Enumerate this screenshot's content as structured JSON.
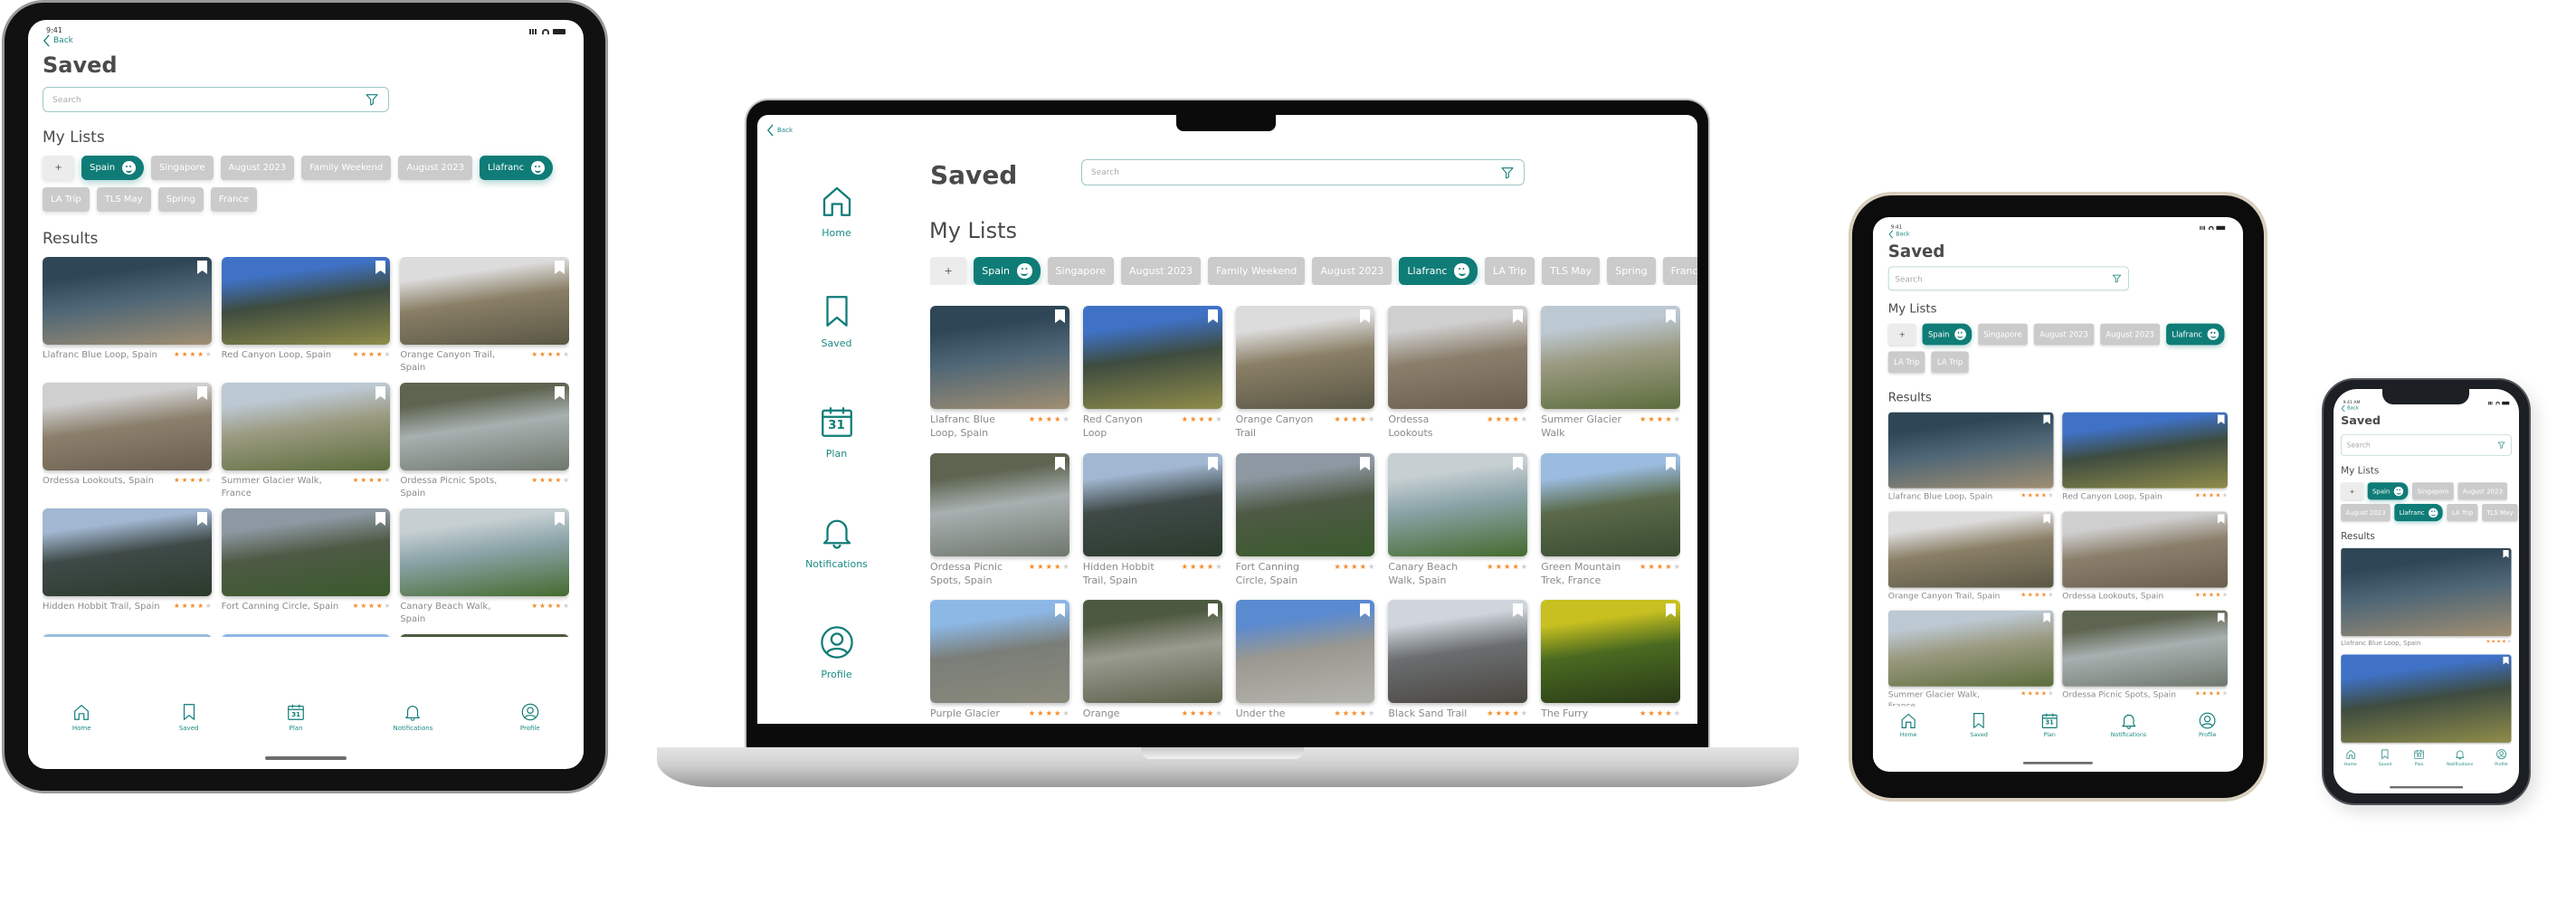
{
  "app": {
    "back": "Back",
    "title": "Saved",
    "search_placeholder": "Search",
    "my_lists": "My Lists",
    "results": "Results",
    "add_list": "+",
    "time": "9:41",
    "phone_time": "9:41 AM"
  },
  "colors": {
    "accent": "#0f7c77",
    "chip_inactive": "#cbcbcb",
    "star": "#f28c28",
    "star_empty": "#cfcfcf",
    "search_border": "#9cc9c6"
  },
  "lists": {
    "ipad": [
      [
        {
          "label": "Spain",
          "active": true
        },
        {
          "label": "Singapore"
        },
        {
          "label": "August 2023"
        },
        {
          "label": "Family Weekend"
        },
        {
          "label": "August 2023"
        },
        {
          "label": "Llafranc",
          "active": true
        }
      ],
      [
        {
          "label": "LA Trip"
        },
        {
          "label": "TLS May"
        },
        {
          "label": "Spring"
        },
        {
          "label": "France"
        }
      ]
    ],
    "laptop": [
      [
        {
          "label": "Spain",
          "active": true
        },
        {
          "label": "Singapore"
        },
        {
          "label": "August 2023"
        },
        {
          "label": "Family Weekend"
        },
        {
          "label": "August 2023"
        },
        {
          "label": "Llafranc",
          "active": true
        },
        {
          "label": "LA Trip"
        },
        {
          "label": "TLS May"
        },
        {
          "label": "Spring"
        },
        {
          "label": "France"
        }
      ]
    ],
    "mini": [
      [
        {
          "label": "Spain",
          "active": true
        },
        {
          "label": "Singapore"
        },
        {
          "label": "August 2023"
        },
        {
          "label": "August 2023"
        },
        {
          "label": "Llafranc",
          "active": true
        }
      ],
      [
        {
          "label": "LA Trip"
        },
        {
          "label": "LA Trip"
        }
      ]
    ],
    "phone": [
      [
        {
          "label": "Spain",
          "active": true
        },
        {
          "label": "Singapore"
        },
        {
          "label": "August 2023"
        }
      ],
      [
        {
          "label": "August 2023"
        },
        {
          "label": "Llafranc",
          "active": true
        },
        {
          "label": "LA Trip"
        },
        {
          "label": "TLS May"
        }
      ]
    ]
  },
  "nav": [
    {
      "label": "Home",
      "icon": "home-icon"
    },
    {
      "label": "Saved",
      "icon": "bookmark-icon"
    },
    {
      "label": "Plan",
      "icon": "calendar-icon",
      "day": "31"
    },
    {
      "label": "Notifications",
      "icon": "bell-icon"
    },
    {
      "label": "Profile",
      "icon": "profile-icon"
    }
  ],
  "results": [
    {
      "name": "Llafranc Blue Loop, Spain",
      "desktop_name": "Llafranc Blue Loop, Spain",
      "rating": 4,
      "palette": [
        "#2f4656",
        "#4e6676",
        "#a08e72"
      ]
    },
    {
      "name": "Red Canyon Loop, Spain",
      "desktop_name": "Red Canyon Loop",
      "rating": 4,
      "palette": [
        "#3f72c6",
        "#3e4c40",
        "#8f8c4a"
      ]
    },
    {
      "name": "Orange Canyon Trail, Spain",
      "desktop_name": "Orange Canyon Trail",
      "rating": 4,
      "palette": [
        "#dcdcdc",
        "#8a7f66",
        "#5a5746"
      ]
    },
    {
      "name": "Ordessa Lookouts, Spain",
      "desktop_name": "Ordessa Lookouts",
      "rating": 4,
      "palette": [
        "#cfcfcf",
        "#8b7f6c",
        "#6a5f50"
      ]
    },
    {
      "name": "Summer Glacier Walk, France",
      "desktop_name": "Summer Glacier Walk",
      "rating": 4,
      "palette": [
        "#bcc8d2",
        "#9a9a80",
        "#5b6d3c"
      ]
    },
    {
      "name": "Ordessa Picnic Spots, Spain",
      "desktop_name": "Ordessa Picnic Spots, Spain",
      "rating": 4,
      "palette": [
        "#5d6450",
        "#a8b0b0",
        "#6e776c"
      ]
    },
    {
      "name": "Hidden Hobbit Trail, Spain",
      "desktop_name": "Hidden Hobbit Trail, Spain",
      "rating": 4,
      "palette": [
        "#a2b8d2",
        "#3f4a48",
        "#2c3a2c"
      ]
    },
    {
      "name": "Fort Canning Circle, Spain",
      "desktop_name": "Fort Canning Circle, Spain",
      "rating": 4,
      "palette": [
        "#8e98a2",
        "#4e5a45",
        "#3a5a2c"
      ]
    },
    {
      "name": "Canary Beach Walk, Spain",
      "desktop_name": "Canary Beach Walk, Spain",
      "rating": 4,
      "palette": [
        "#c6cfd2",
        "#8aa3a8",
        "#456b2e"
      ]
    },
    {
      "name": "Green Mountain Trek, France",
      "desktop_name": "Green Mountain Trek, France",
      "rating": 4,
      "palette": [
        "#9bbce0",
        "#5a6a4a",
        "#3a4a30"
      ]
    },
    {
      "name": "Purple Glacier",
      "desktop_name": "Purple Glacier",
      "rating": 4,
      "palette": [
        "#8db8e6",
        "#7a7e78",
        "#8a8a7c"
      ]
    },
    {
      "name": "Orange",
      "desktop_name": "Orange",
      "rating": 4,
      "palette": [
        "#4e5a40",
        "#9a9a90",
        "#5a6048"
      ]
    },
    {
      "name": "Under the",
      "desktop_name": "Under the",
      "rating": 4,
      "palette": [
        "#5a8ad0",
        "#9a9890",
        "#b4b4ae"
      ]
    },
    {
      "name": "Black Sand Trail",
      "desktop_name": "Black Sand Trail",
      "rating": 4,
      "palette": [
        "#d0d5dc",
        "#6a6e70",
        "#4a4640"
      ]
    },
    {
      "name": "The Furry",
      "desktop_name": "The Furry",
      "rating": 4,
      "palette": [
        "#c8c020",
        "#4a6a20",
        "#2a3a18"
      ]
    }
  ]
}
